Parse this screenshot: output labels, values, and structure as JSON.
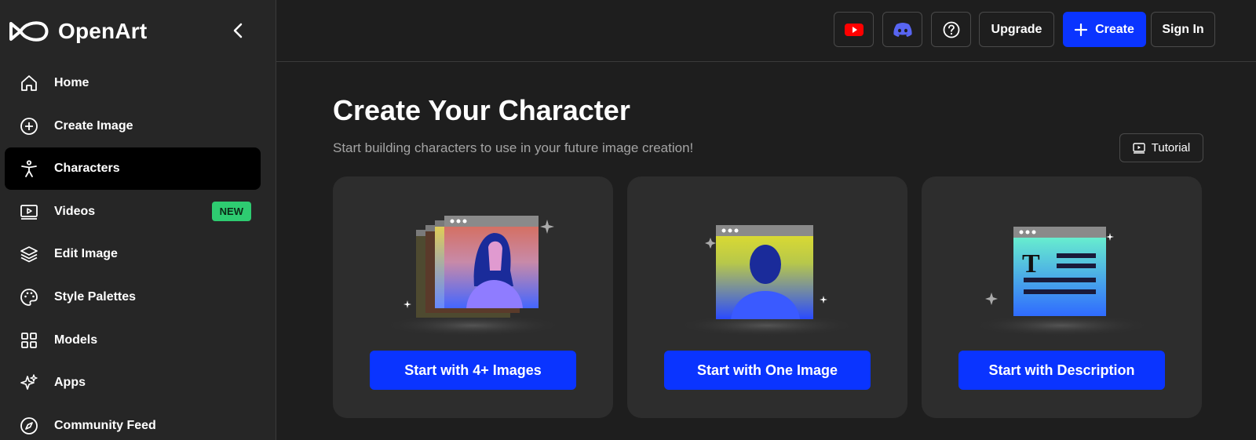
{
  "brand": {
    "name": "OpenArt"
  },
  "sidebar": {
    "items": [
      {
        "label": "Home",
        "icon": "home-icon"
      },
      {
        "label": "Create Image",
        "icon": "plus-circle-icon"
      },
      {
        "label": "Characters",
        "icon": "person-icon",
        "active": true
      },
      {
        "label": "Videos",
        "icon": "video-icon",
        "badge": "NEW"
      },
      {
        "label": "Edit Image",
        "icon": "layers-icon"
      },
      {
        "label": "Style Palettes",
        "icon": "palette-icon"
      },
      {
        "label": "Models",
        "icon": "grid-icon"
      },
      {
        "label": "Apps",
        "icon": "sparkles-icon"
      },
      {
        "label": "Community Feed",
        "icon": "compass-icon"
      }
    ]
  },
  "topbar": {
    "upgrade_label": "Upgrade",
    "create_label": "Create",
    "signin_label": "Sign In"
  },
  "main": {
    "title": "Create Your Character",
    "subtitle": "Start building characters to use in your future image creation!",
    "tutorial_label": "Tutorial",
    "cards": [
      {
        "button_label": "Start with 4+ Images"
      },
      {
        "button_label": "Start with One Image"
      },
      {
        "button_label": "Start with Description"
      }
    ]
  },
  "colors": {
    "accent": "#0a34ff",
    "badge": "#2ecc71",
    "youtube": "#ff0000",
    "discord": "#5865f2"
  }
}
